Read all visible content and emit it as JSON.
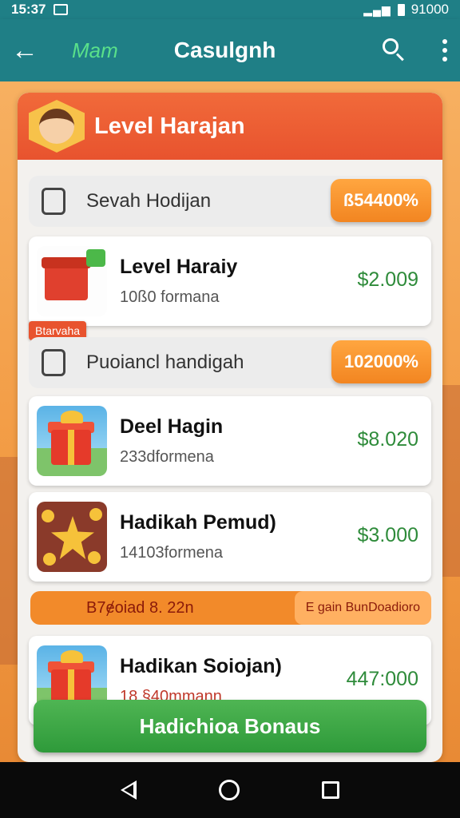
{
  "status_bar": {
    "time": "15:37",
    "right_text": "91000"
  },
  "app_bar": {
    "subtitle": "Mam",
    "title": "Casulgnh"
  },
  "header": {
    "title": "Level Harajan"
  },
  "sections": [
    {
      "label": "Sevah Hodijan",
      "pill": "ß54400%"
    },
    {
      "label": "Puoiancl handigah",
      "pill": "102000%"
    }
  ],
  "small_tag": "Btarvaha",
  "items": [
    {
      "name": "Level Haraiy",
      "meta": "10ß0 formana",
      "price": "$2.009"
    },
    {
      "name": "Deel Hagin",
      "meta": "233dformena",
      "price": "$8.020"
    },
    {
      "name": "Hadikah Pemud)",
      "meta": "14103formena",
      "price": "$3.000"
    },
    {
      "name": "Hadikan Soiojan)",
      "meta": "18 §40mmann",
      "price": "447:000"
    }
  ],
  "promo": {
    "text": "B7ɇoiad 8. 22n",
    "button": "E gain BunDoadioro"
  },
  "bonus_button": "Hadichioa Bonaus",
  "colors": {
    "teal": "#1f7f86",
    "orange": "#f28521",
    "green": "#2e9a3a",
    "red": "#e8532e"
  }
}
